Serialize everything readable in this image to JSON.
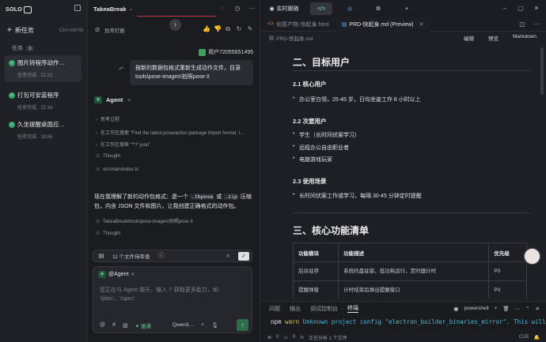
{
  "sidebar": {
    "logo": "SOLO",
    "new_task": "新任务",
    "new_task_shortcut": "Ctrl+Alt+N",
    "tasks_label": "任务",
    "tasks_count": "3",
    "tasks": [
      {
        "title": "图片转程序动作…",
        "status": "任务完成 · 22:22"
      },
      {
        "title": "打包可安装程序",
        "status": "任务完成 · 22:16"
      },
      {
        "title": "久坐提醒桌面应…",
        "status": "任务完成 · 19:55"
      }
    ]
  },
  "chat": {
    "title": "TakeaBreak",
    "interrupted": "异常打断",
    "user_name": "用户72055651495",
    "user_message": "按新的数据包格式重新生成动作文件，目录 tools\\pose-images\\拍照pose II",
    "agent_name": "Agent",
    "steps": [
      "思考过程",
      "在工作区搜索 \"Find the latest pose/action package import format, t…",
      "在工作区搜索 \"**/*.json\"",
      "Thought",
      "src\\main\\index.ts"
    ],
    "reply_a": "现在我理解了新的动作包格式：是一个 ",
    "reply_code1": ".tbpose",
    "reply_mid": " 或 ",
    "reply_code2": ".zip",
    "reply_b": " 压缩包，内含 JSON 文件和图片。让我创建正确格式的动作包。",
    "path_step": "TakeaBreak\\tools\\pose-images\\拍照pose II",
    "thought2": "Thought",
    "pending": "11 个文件待审查",
    "mention": "@Agent",
    "placeholder": "您正在与 Agent 聊天，输入 '/' 获取更多能力，如 '/plan'，'/spec'",
    "speed": "速通",
    "model": "Qwen3…"
  },
  "editor": {
    "live_label": "实时跟随",
    "tabs": [
      {
        "label": "创意产物·快起身.html",
        "active": false
      },
      {
        "label": "PRD-快起身.md (Preview)",
        "active": true
      }
    ],
    "crumb": "PRD-快起身.md",
    "modes": [
      "编辑",
      "预览",
      "Markdown"
    ],
    "h2_users": "二、目标用户",
    "h3_core": "2.1 核心用户",
    "core_item": "办公室白领，25-45 岁，日均坐姿工作 8 小时以上",
    "h3_secondary": "2.2 次要用户",
    "secondary_items": [
      "学生（长时间伏案学习）",
      "远程办公自由职业者",
      "电脑游戏玩家"
    ],
    "h3_scene": "2.3 使用场景",
    "scene_item": "长时间伏案工作或学习，每隔 30-45 分钟定时提醒",
    "h2_features": "三、核心功能清单",
    "table_headers": [
      "功能模块",
      "功能描述",
      "优先级"
    ],
    "table_rows": [
      [
        "后台驻存",
        "系统托盘驻留，低功耗运行，定时器计时",
        "P0"
      ],
      [
        "提醒弹窗",
        "计时结束后弹出提醒窗口",
        "P0"
      ]
    ]
  },
  "terminal": {
    "tabs": [
      "问题",
      "输出",
      "调试控制台",
      "终端"
    ],
    "shell": "powershell",
    "npm": "npm",
    "warn": "warn",
    "message": "Unknown project config \"electron_builder_binaries_mirror\". This will"
  },
  "statusbar": {
    "errors": "0",
    "warnings": "0",
    "analyzing": "正在分析 1 个文件",
    "encoding": "CUE"
  }
}
